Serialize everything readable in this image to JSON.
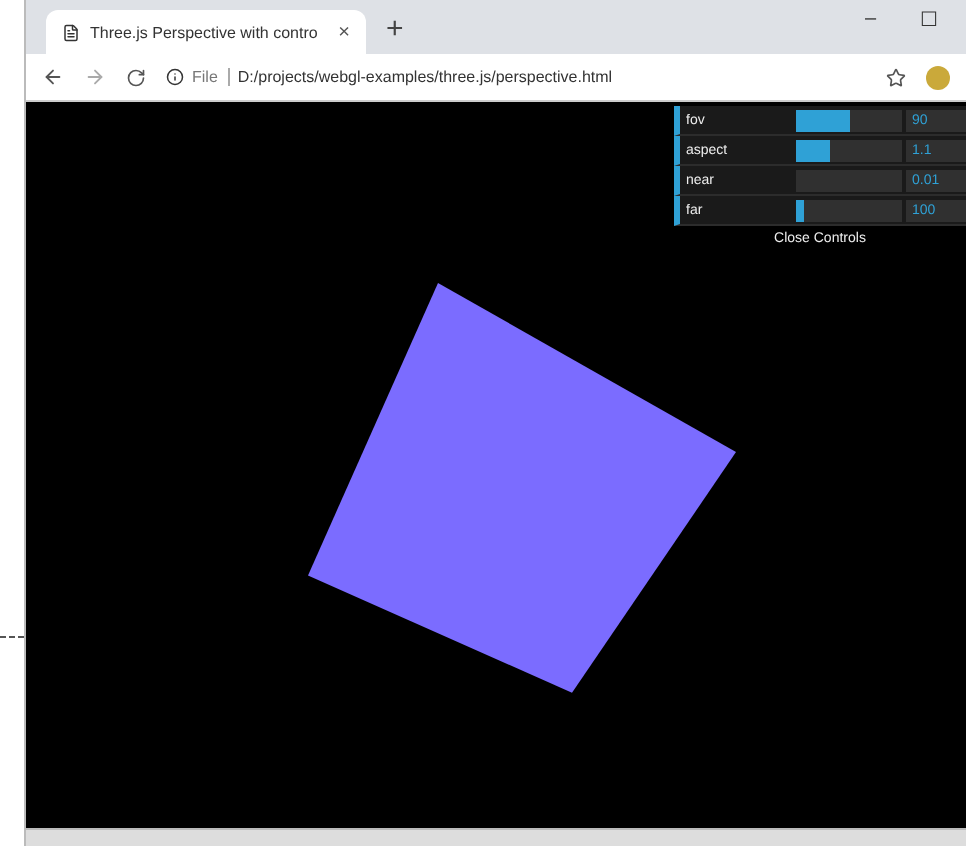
{
  "tab": {
    "title": "Three.js Perspective with contro",
    "close": "×",
    "new_tab": "+"
  },
  "window_controls": {
    "minimize": "–",
    "maximize": "☐"
  },
  "address_bar": {
    "scheme": "File",
    "url": "D:/projects/webgl-examples/three.js/perspective.html"
  },
  "controls": [
    {
      "label": "fov",
      "level": 0.5,
      "value": "90"
    },
    {
      "label": "aspect",
      "level": 0.33,
      "value": "1.1"
    },
    {
      "label": "near",
      "value": "0.01"
    },
    {
      "label": "far",
      "level": 0.07,
      "value": "100"
    }
  ],
  "close_controls": "Close Controls"
}
